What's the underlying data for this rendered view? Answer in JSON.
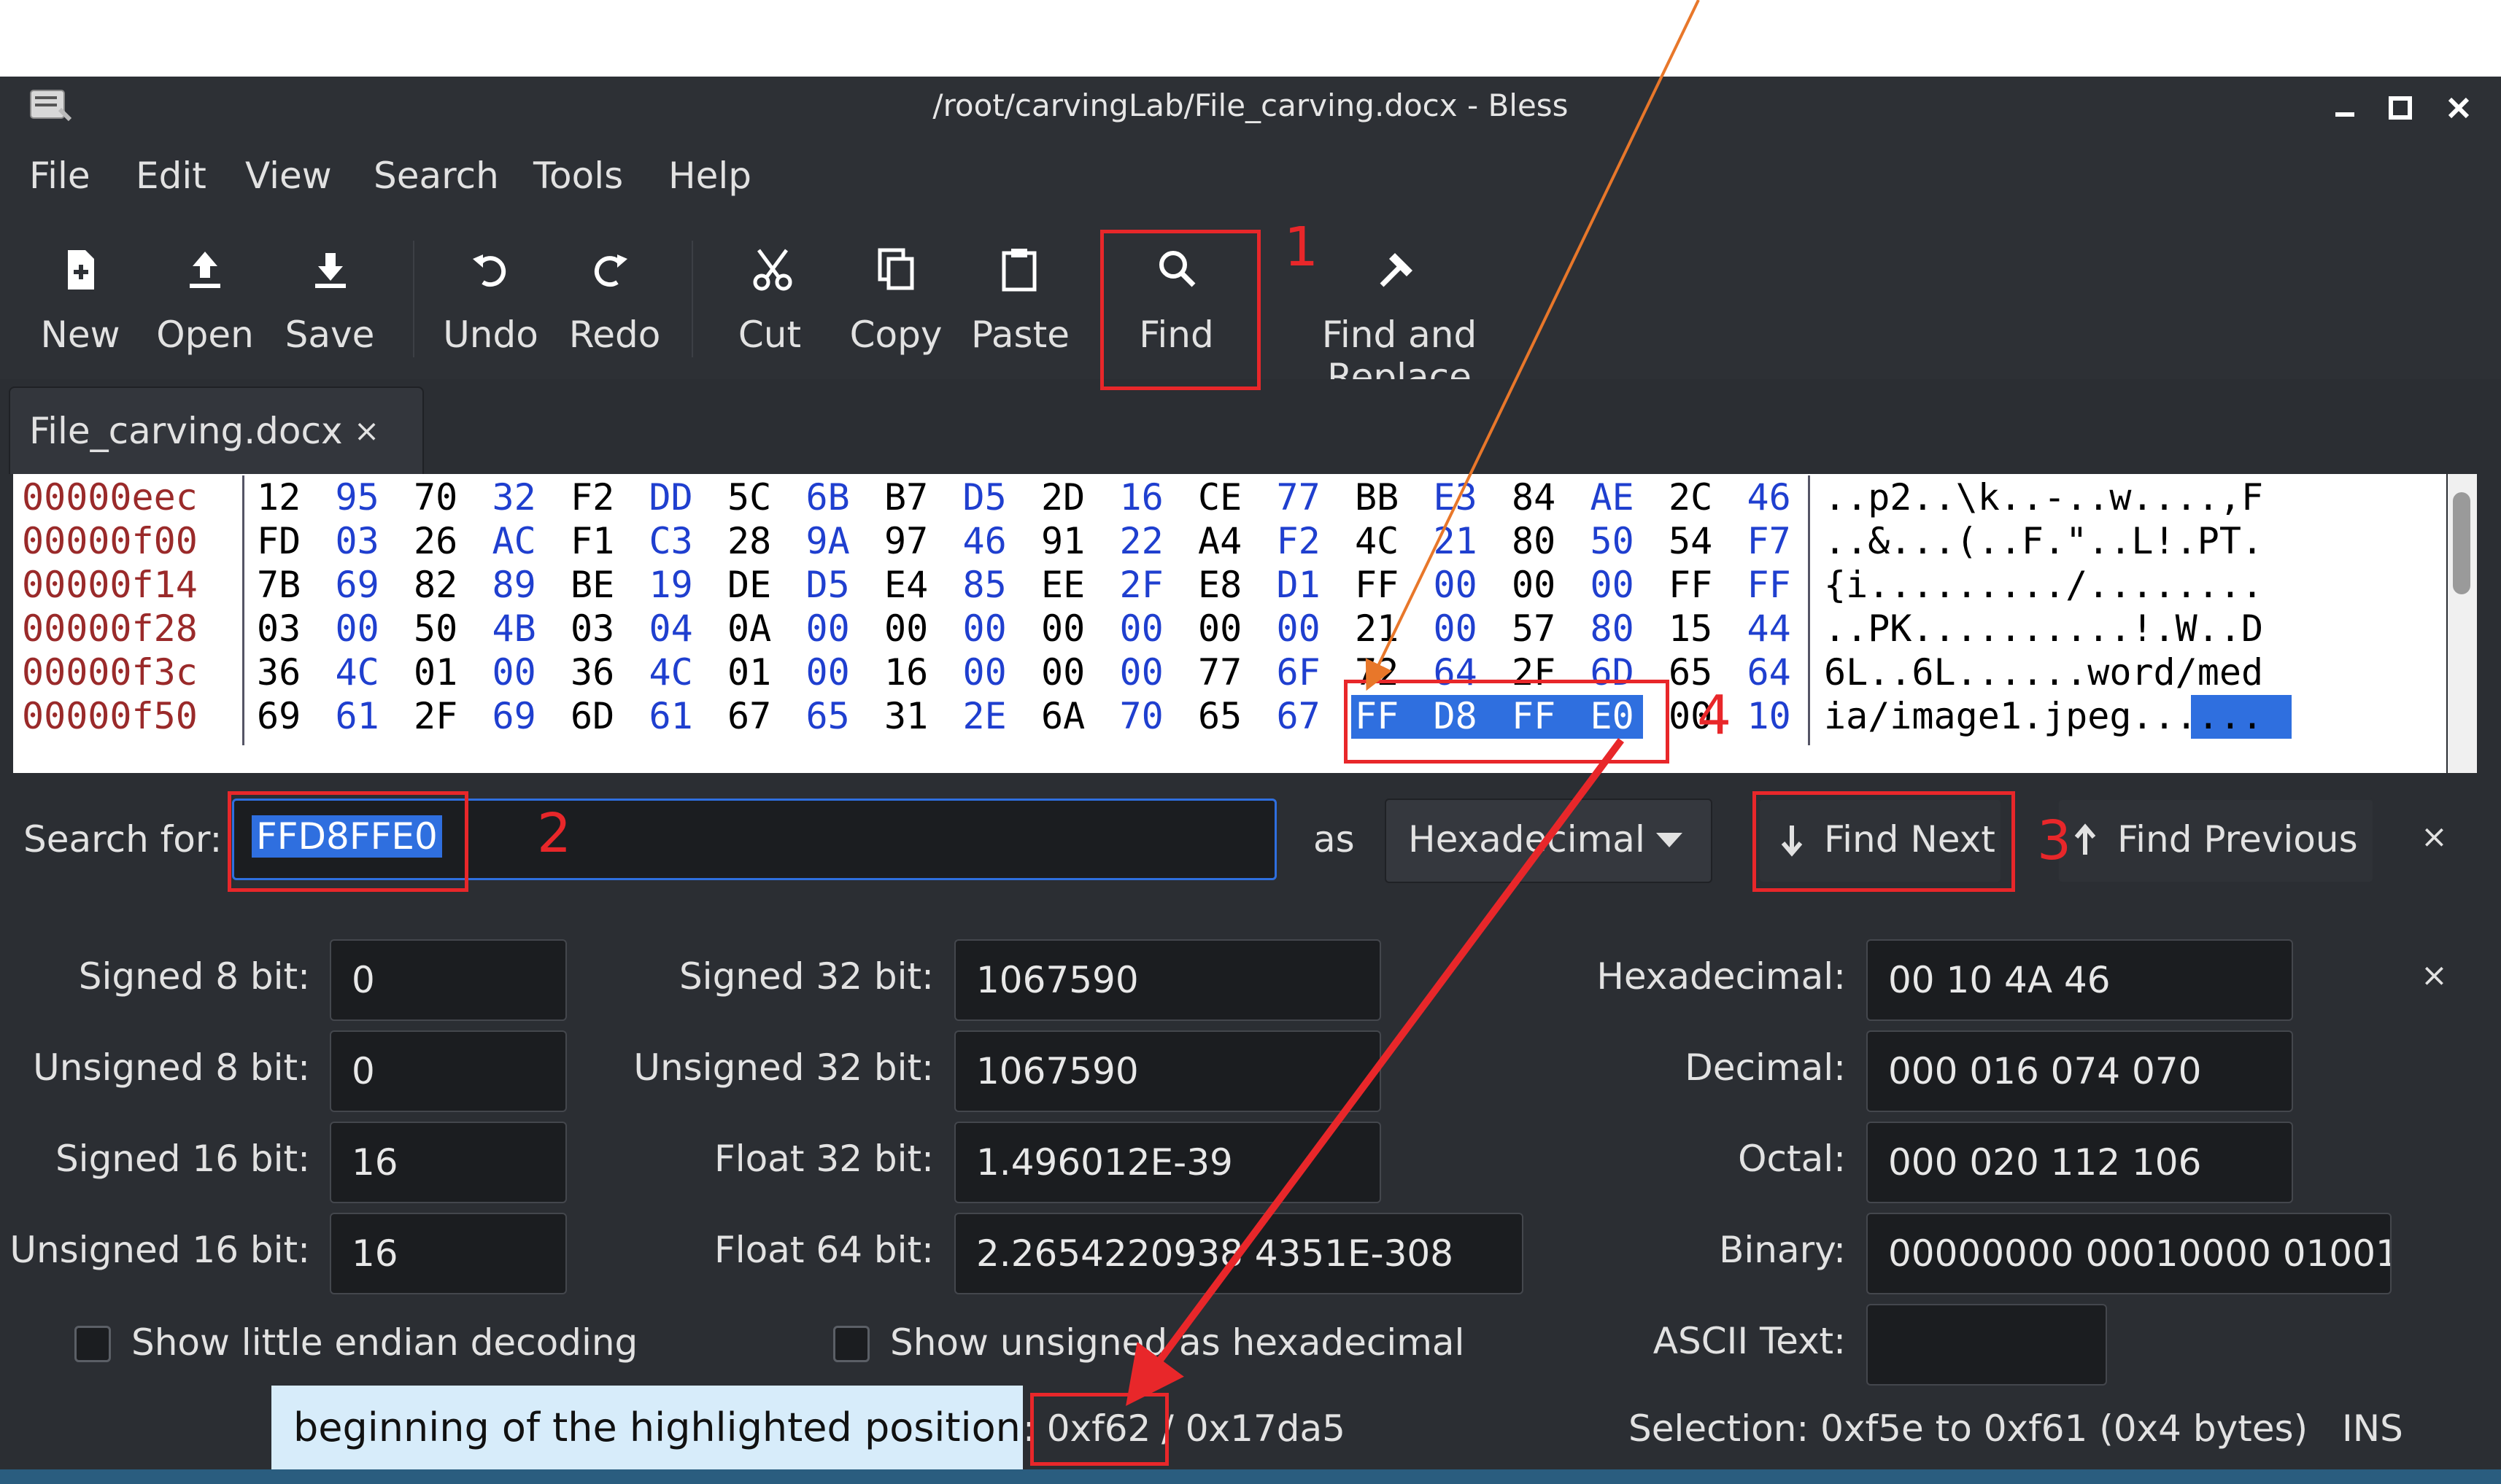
{
  "window": {
    "title": "/root/carvingLab/File_carving.docx - Bless",
    "controls": [
      "minimize-icon",
      "maximize-icon",
      "close-icon"
    ]
  },
  "menu": [
    "File",
    "Edit",
    "View",
    "Search",
    "Tools",
    "Help"
  ],
  "toolbar": {
    "new": "New",
    "open": "Open",
    "save": "Save",
    "undo": "Undo",
    "redo": "Redo",
    "cut": "Cut",
    "copy": "Copy",
    "paste": "Paste",
    "find": "Find",
    "find_replace": "Find and Replace"
  },
  "tab": {
    "label": "File_carving.docx",
    "close": "×"
  },
  "hex": {
    "rows": [
      {
        "offset": "00000eec",
        "bytes": [
          "12",
          "95",
          "70",
          "32",
          "F2",
          "DD",
          "5C",
          "6B",
          "B7",
          "D5",
          "2D",
          "16",
          "CE",
          "77",
          "BB",
          "E3",
          "84",
          "AE",
          "2C",
          "46"
        ],
        "ascii": "..p2..\\k..-..w....,F"
      },
      {
        "offset": "00000f00",
        "bytes": [
          "FD",
          "03",
          "26",
          "AC",
          "F1",
          "C3",
          "28",
          "9A",
          "97",
          "46",
          "91",
          "22",
          "A4",
          "F2",
          "4C",
          "21",
          "80",
          "50",
          "54",
          "F7"
        ],
        "ascii": "..&...(..F.\"..L!.PT."
      },
      {
        "offset": "00000f14",
        "bytes": [
          "7B",
          "69",
          "82",
          "89",
          "BE",
          "19",
          "DE",
          "D5",
          "E4",
          "85",
          "EE",
          "2F",
          "E8",
          "D1",
          "FF",
          "00",
          "00",
          "00",
          "FF",
          "FF"
        ],
        "ascii": "{i........./........"
      },
      {
        "offset": "00000f28",
        "bytes": [
          "03",
          "00",
          "50",
          "4B",
          "03",
          "04",
          "0A",
          "00",
          "00",
          "00",
          "00",
          "00",
          "00",
          "00",
          "21",
          "00",
          "57",
          "80",
          "15",
          "44"
        ],
        "ascii": "..PK..........!.W..D"
      },
      {
        "offset": "00000f3c",
        "bytes": [
          "36",
          "4C",
          "01",
          "00",
          "36",
          "4C",
          "01",
          "00",
          "16",
          "00",
          "00",
          "00",
          "77",
          "6F",
          "72",
          "64",
          "2F",
          "6D",
          "65",
          "64"
        ],
        "ascii": "6L..6L......word/med"
      },
      {
        "offset": "00000f50",
        "bytes": [
          "69",
          "61",
          "2F",
          "69",
          "6D",
          "61",
          "67",
          "65",
          "31",
          "2E",
          "6A",
          "70",
          "65",
          "67",
          "FF",
          "D8",
          "FF",
          "E0",
          "00",
          "10"
        ],
        "ascii": "ia/image1.jpeg......"
      }
    ]
  },
  "search": {
    "label": "Search for:",
    "value": "FFD8FFE0",
    "as_label": "as",
    "mode": "Hexadecimal",
    "find_next": "Find Next",
    "find_previous": "Find Previous",
    "close": "×"
  },
  "conversion": {
    "left": [
      {
        "label": "Signed 8 bit:",
        "value": "0"
      },
      {
        "label": "Unsigned 8 bit:",
        "value": "0"
      },
      {
        "label": "Signed 16 bit:",
        "value": "16"
      },
      {
        "label": "Unsigned 16 bit:",
        "value": "16"
      }
    ],
    "middle": [
      {
        "label": "Signed 32 bit:",
        "value": "1067590"
      },
      {
        "label": "Unsigned 32 bit:",
        "value": "1067590"
      },
      {
        "label": "Float 32 bit:",
        "value": "1.496012E-39"
      },
      {
        "label": "Float 64 bit:",
        "value": "2.2654220938 4351E-308"
      }
    ],
    "right": [
      {
        "label": "Hexadecimal:",
        "value": "00 10 4A 46"
      },
      {
        "label": "Decimal:",
        "value": "000 016 074 070"
      },
      {
        "label": "Octal:",
        "value": "000 020 112 106"
      },
      {
        "label": "Binary:",
        "value": "00000000 00010000 01001"
      },
      {
        "label": "ASCII Text:",
        "value": ""
      }
    ],
    "little_endian": "Show little endian decoding",
    "unsigned_hex": "Show unsigned as hexadecimal",
    "close": "×"
  },
  "status": {
    "offset": ": 0xf62",
    "total": "/ 0x17da5",
    "selection": "Selection: 0xf5e to 0xf61 (0x4 bytes)",
    "mode": "INS"
  },
  "annotations": {
    "n1": "1",
    "n2": "2",
    "n3": "3",
    "n4": "4",
    "callout": "beginning of the highlighted position"
  },
  "colors": {
    "accent": "#2f6fdf",
    "annotation_red": "#e8272a",
    "annotation_orange": "#e8772a"
  }
}
